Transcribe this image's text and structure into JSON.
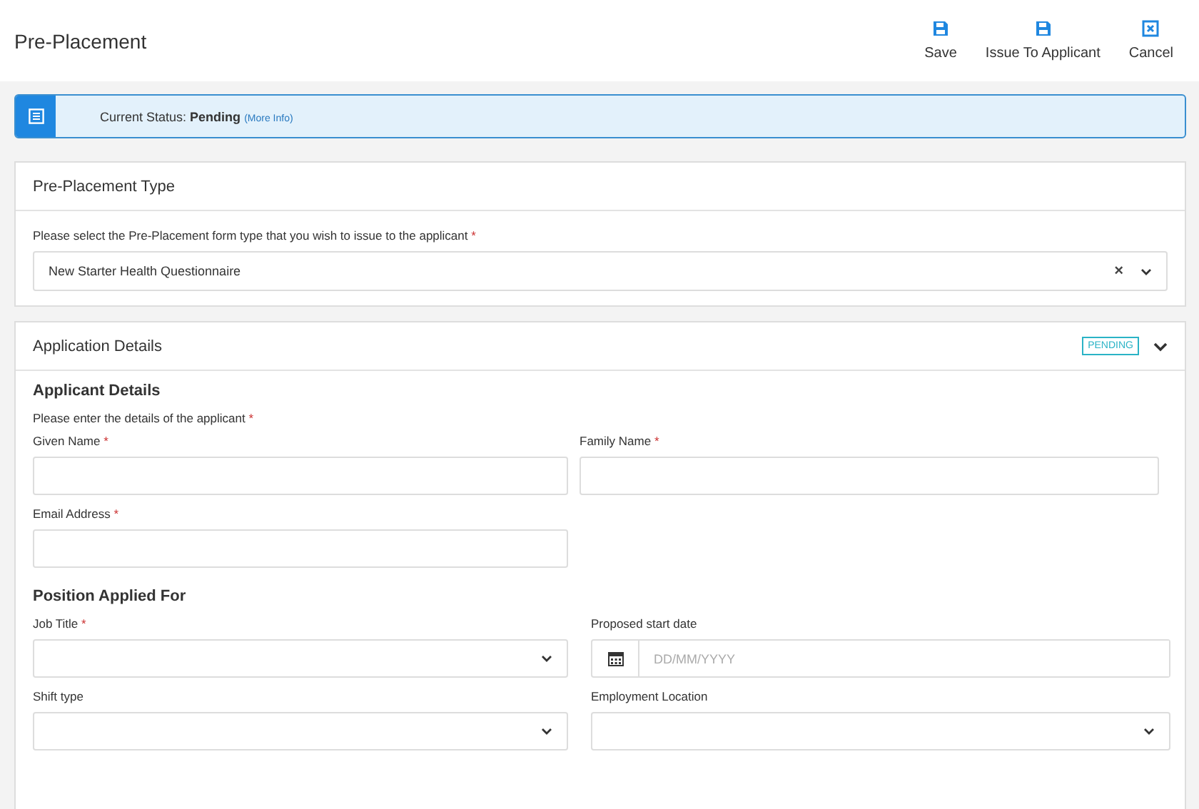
{
  "header": {
    "title": "Pre-Placement",
    "actions": [
      {
        "kind": "save",
        "label": "Save"
      },
      {
        "kind": "save",
        "label": "Issue To Applicant"
      },
      {
        "kind": "cancel",
        "label": "Cancel"
      }
    ]
  },
  "status": {
    "label": "Current Status:",
    "value": "Pending",
    "link": "(More Info)"
  },
  "type_card": {
    "title": "Pre-Placement Type",
    "prompt": "Please select the Pre-Placement form type that you wish to issue to the applicant",
    "required_mark": "*",
    "value": "New Starter Health Questionnaire",
    "clear": "×"
  },
  "details_card": {
    "title": "Application Details",
    "badge": "PENDING",
    "expanded": true,
    "sections": [
      {
        "heading": "Applicant Details",
        "prompt": "Please enter the details of the applicant",
        "required_mark": "*",
        "fields": [
          {
            "kind": "text",
            "label": "Given Name",
            "required_mark": "*"
          },
          {
            "kind": "text",
            "label": "Family Name",
            "required_mark": "*"
          },
          {
            "kind": "text",
            "label": "Email Address",
            "required_mark": "*"
          }
        ]
      },
      {
        "heading": "Position Applied For",
        "fields": [
          {
            "kind": "select",
            "label": "Job Title",
            "required_mark": "*"
          },
          {
            "kind": "date",
            "label": "Proposed start date",
            "placeholder": "DD/MM/YYYY"
          },
          {
            "kind": "select",
            "label": "Shift type"
          },
          {
            "kind": "select",
            "label": "Employment Location"
          }
        ]
      }
    ]
  }
}
